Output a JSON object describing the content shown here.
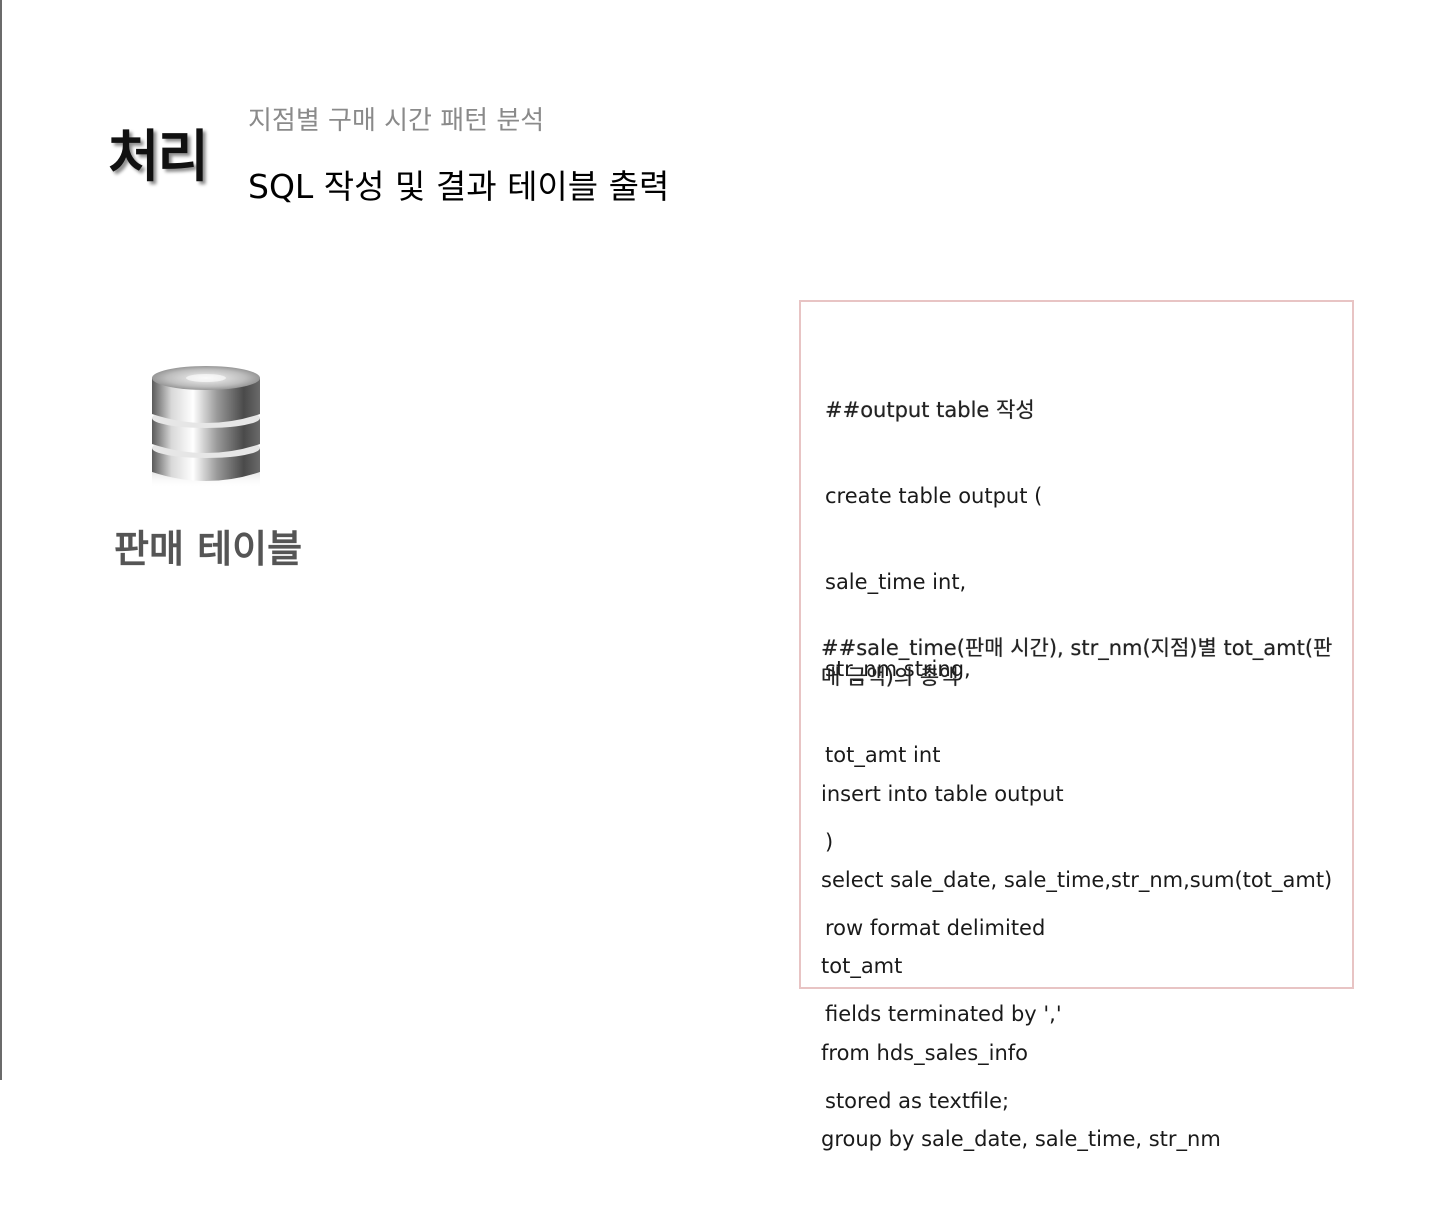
{
  "header": {
    "section_title": "처리",
    "subtitle": "지점별 구매 시간 패턴 분석",
    "heading": "SQL 작성 및 결과 테이블 출력"
  },
  "left_panel": {
    "icon": "database-icon",
    "table_label": "판매 테이블"
  },
  "code": {
    "block1": {
      "comment": "##output table 작성",
      "lines": [
        "create table output (",
        "sale_time int,",
        "str_nm string,",
        "tot_amt int",
        ")",
        "row format delimited",
        "fields terminated by ','",
        "stored as textfile;"
      ]
    },
    "block2": {
      "comment": "##sale_time(판매 시간), str_nm(지점)별 tot_amt(판매 금액)의 총액"
    },
    "block3": {
      "lines": [
        "insert into table output",
        "select sale_date, sale_time,str_nm,sum(tot_amt)",
        "tot_amt",
        "from hds_sales_info",
        "group by sale_date, sale_time, str_nm"
      ]
    }
  },
  "colors": {
    "code_box_border": "#e8c4c4",
    "subtitle": "#8a8a8a",
    "table_label": "#555555"
  }
}
